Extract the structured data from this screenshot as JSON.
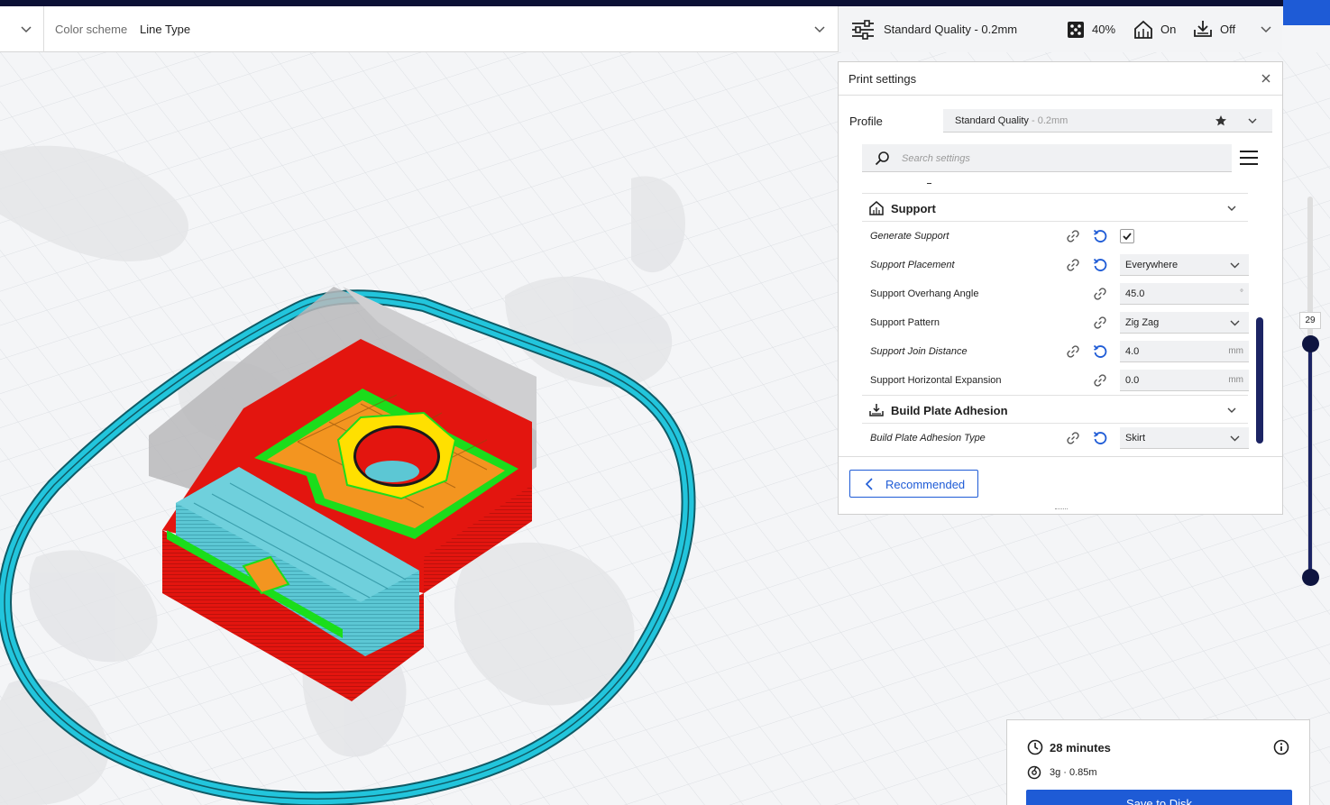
{
  "toolbar": {
    "color_scheme_label": "Color scheme",
    "color_scheme_value": "Line Type",
    "quality": "Standard Quality - 0.2mm",
    "infill": "40%",
    "support": "On",
    "adhesion": "Off"
  },
  "panel": {
    "title": "Print settings",
    "profile_label": "Profile",
    "profile_name": "Standard Quality",
    "profile_sub": " - 0.2mm",
    "search_placeholder": "Search settings",
    "categories": {
      "support": "Support",
      "adhesion": "Build Plate Adhesion"
    },
    "settings": [
      {
        "label": "Generate Support"
      },
      {
        "label": "Support Placement",
        "value": "Everywhere"
      },
      {
        "label": "Support Overhang Angle",
        "value": "45.0",
        "unit": "°"
      },
      {
        "label": "Support Pattern",
        "value": "Zig Zag"
      },
      {
        "label": "Support Join Distance",
        "value": "4.0",
        "unit": "mm"
      },
      {
        "label": "Support Horizontal Expansion",
        "value": "0.0",
        "unit": "mm"
      },
      {
        "label": "Build Plate Adhesion Type",
        "value": "Skirt"
      }
    ],
    "recommended_label": "Recommended"
  },
  "layer_slider": {
    "current": "29",
    "position": 0.62
  },
  "estimate": {
    "time": "28 minutes",
    "material": "3g · 0.85m",
    "save_label": "Save to Disk"
  },
  "colors": {
    "accent": "#1e5bd6",
    "dark": "#0b1035",
    "wall": "#e3150f",
    "infill": "#f39520",
    "skin": "#ffe000",
    "support": "#5cc7d4",
    "inner_wall": "#1bdd1b",
    "skirt": "#22c5dc"
  }
}
